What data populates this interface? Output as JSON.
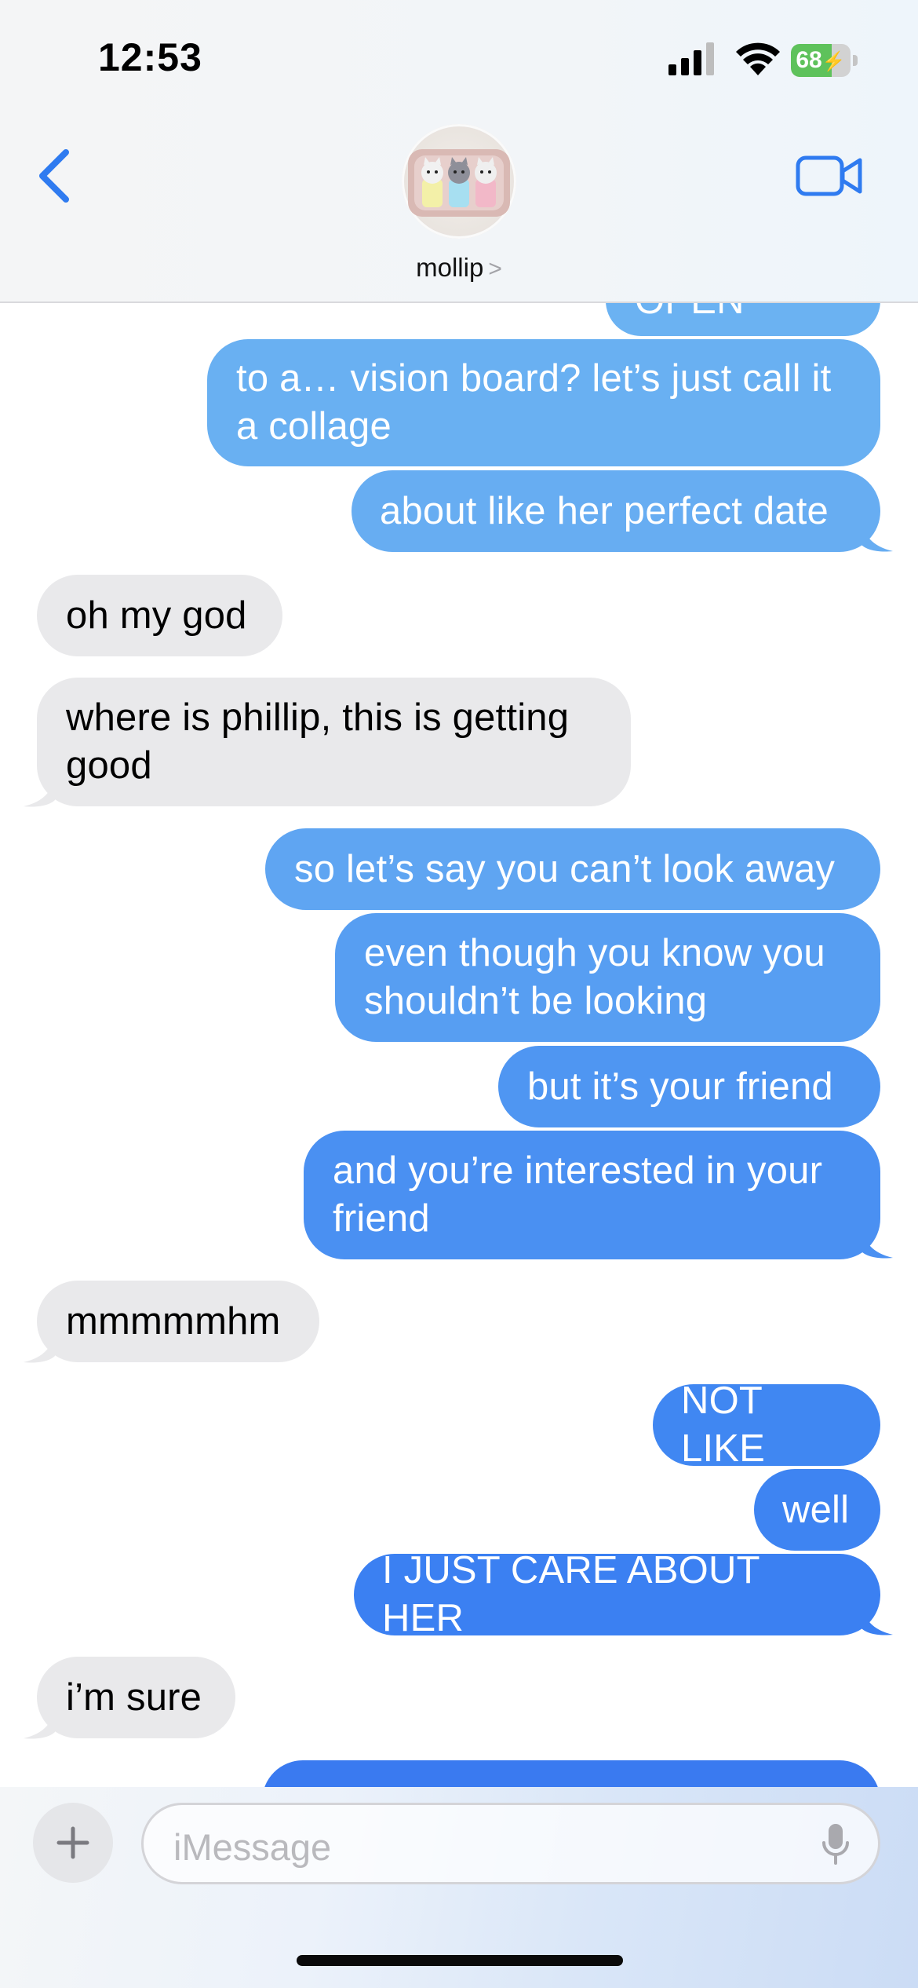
{
  "status_bar": {
    "time": "12:53",
    "battery": "68",
    "battery_fraction": 0.68
  },
  "header": {
    "contact_name": "mollip",
    "contact_chevron": ">",
    "icons": [
      "chevron-left-icon",
      "video-camera-icon"
    ]
  },
  "messages": [
    {
      "dir": "out",
      "text": "it was OPEN"
    },
    {
      "dir": "out",
      "text": "to a… vision board? let’s just call it a collage"
    },
    {
      "dir": "out",
      "text": "about like her perfect date"
    },
    {
      "dir": "in",
      "text": "oh my god"
    },
    {
      "dir": "in",
      "text": "where is phillip, this is getting good"
    },
    {
      "dir": "out",
      "text": "so let’s say you can’t look away"
    },
    {
      "dir": "out",
      "text": "even though you know you shouldn’t be looking"
    },
    {
      "dir": "out",
      "text": "but it’s your friend"
    },
    {
      "dir": "out",
      "text": "and you’re interested in your friend"
    },
    {
      "dir": "in",
      "text": "mmmmmhm"
    },
    {
      "dir": "out",
      "text": "NOT LIKE"
    },
    {
      "dir": "out",
      "text": "well"
    },
    {
      "dir": "out",
      "text": "I JUST CARE ABOUT HER"
    },
    {
      "dir": "in",
      "text": "i’m sure"
    }
  ],
  "composer": {
    "placeholder": "iMessage",
    "icons": [
      "plus-icon",
      "microphone-icon"
    ]
  },
  "colors": {
    "outgoing_top": "#6db2f2",
    "outgoing_bottom": "#3a7af0",
    "incoming": "#e9e9eb",
    "accent": "#2f7bf0"
  }
}
